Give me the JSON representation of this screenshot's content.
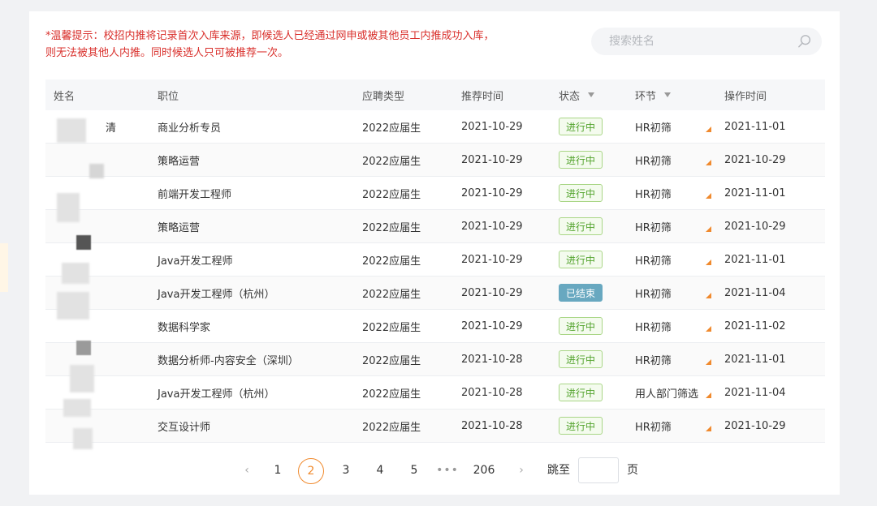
{
  "notice": "*温馨提示：校招内推将记录首次入库来源，即候选人已经通过网申或被其他员工内推成功入库，则无法被其他人内推。同时候选人只可被推荐一次。",
  "search": {
    "placeholder": "搜索姓名"
  },
  "columns": {
    "name": "姓名",
    "position": "职位",
    "type": "应聘类型",
    "time": "推荐时间",
    "status": "状态",
    "stage": "环节",
    "op_time": "操作时间"
  },
  "rows": [
    {
      "name": "清",
      "position": "商业分析专员",
      "type": "2022应届生",
      "time": "2021-10-29",
      "status": "进行中",
      "stage": "HR初筛",
      "op_time": "2021-11-01"
    },
    {
      "name": "",
      "position": "策略运营",
      "type": "2022应届生",
      "time": "2021-10-29",
      "status": "进行中",
      "stage": "HR初筛",
      "op_time": "2021-10-29"
    },
    {
      "name": "",
      "position": "前端开发工程师",
      "type": "2022应届生",
      "time": "2021-10-29",
      "status": "进行中",
      "stage": "HR初筛",
      "op_time": "2021-11-01"
    },
    {
      "name": "",
      "position": "策略运营",
      "type": "2022应届生",
      "time": "2021-10-29",
      "status": "进行中",
      "stage": "HR初筛",
      "op_time": "2021-10-29"
    },
    {
      "name": "",
      "position": "Java开发工程师",
      "type": "2022应届生",
      "time": "2021-10-29",
      "status": "进行中",
      "stage": "HR初筛",
      "op_time": "2021-11-01"
    },
    {
      "name": "",
      "position": "Java开发工程师（杭州）",
      "type": "2022应届生",
      "time": "2021-10-29",
      "status": "已结束",
      "stage": "HR初筛",
      "op_time": "2021-11-04"
    },
    {
      "name": "",
      "position": "数据科学家",
      "type": "2022应届生",
      "time": "2021-10-29",
      "status": "进行中",
      "stage": "HR初筛",
      "op_time": "2021-11-02"
    },
    {
      "name": "",
      "position": "数据分析师-内容安全（深圳）",
      "type": "2022应届生",
      "time": "2021-10-28",
      "status": "进行中",
      "stage": "HR初筛",
      "op_time": "2021-11-01"
    },
    {
      "name": "",
      "position": "Java开发工程师（杭州）",
      "type": "2022应届生",
      "time": "2021-10-28",
      "status": "进行中",
      "stage": "用人部门筛选",
      "op_time": "2021-11-04"
    },
    {
      "name": "",
      "position": "交互设计师",
      "type": "2022应届生",
      "time": "2021-10-28",
      "status": "进行中",
      "stage": "HR初筛",
      "op_time": "2021-10-29"
    }
  ],
  "pagination": {
    "prev": "‹",
    "pages": [
      "1",
      "2",
      "3",
      "4",
      "5"
    ],
    "current": "2",
    "ellipsis": "•••",
    "last": "206",
    "next": "›",
    "jump_label": "跳至",
    "page_unit": "页",
    "jump_value": ""
  }
}
